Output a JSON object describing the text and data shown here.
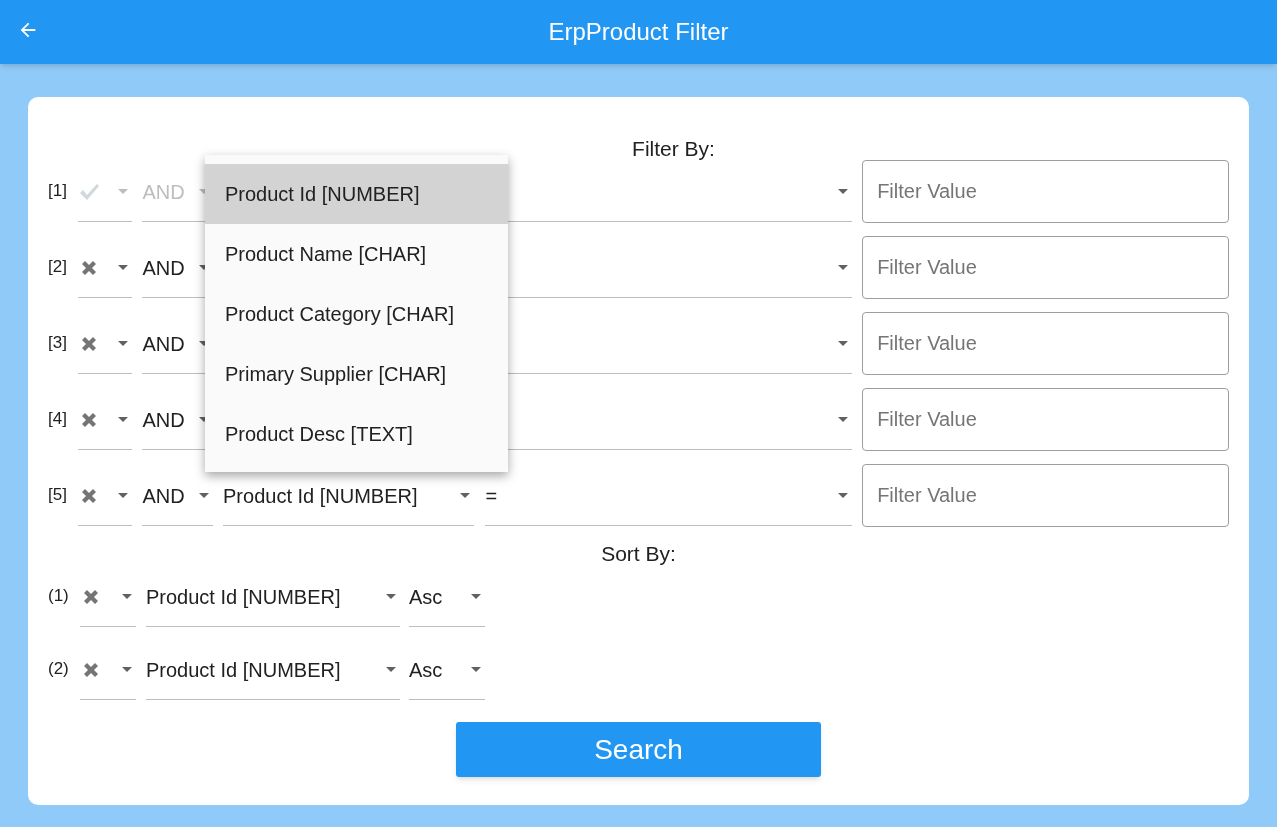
{
  "app_bar": {
    "title": "ErpProduct Filter"
  },
  "filter_heading": "Filter By:",
  "filters": [
    {
      "index": "[1]",
      "enabled": false,
      "conjunction": "AND",
      "value_placeholder": "Filter Value"
    },
    {
      "index": "[2]",
      "enabled": true,
      "conjunction": "AND",
      "value_placeholder": "Filter Value"
    },
    {
      "index": "[3]",
      "enabled": true,
      "conjunction": "AND",
      "value_placeholder": "Filter Value"
    },
    {
      "index": "[4]",
      "enabled": true,
      "conjunction": "AND",
      "value_placeholder": "Filter Value"
    },
    {
      "index": "[5]",
      "enabled": true,
      "conjunction": "AND",
      "field": "Product Id [NUMBER]",
      "operator": "=",
      "value_placeholder": "Filter Value"
    }
  ],
  "field_menu": [
    {
      "label": "Product Id [NUMBER]",
      "selected": true
    },
    {
      "label": "Product Name [CHAR]",
      "selected": false
    },
    {
      "label": "Product Category [CHAR]",
      "selected": false
    },
    {
      "label": "Primary Supplier [CHAR]",
      "selected": false
    },
    {
      "label": "Product Desc [TEXT]",
      "selected": false
    }
  ],
  "sort_heading": "Sort By:",
  "sorts": [
    {
      "index": "(1)",
      "enabled": true,
      "field": "Product Id [NUMBER]",
      "direction": "Asc"
    },
    {
      "index": "(2)",
      "enabled": true,
      "field": "Product Id [NUMBER]",
      "direction": "Asc"
    }
  ],
  "search_button": "Search"
}
